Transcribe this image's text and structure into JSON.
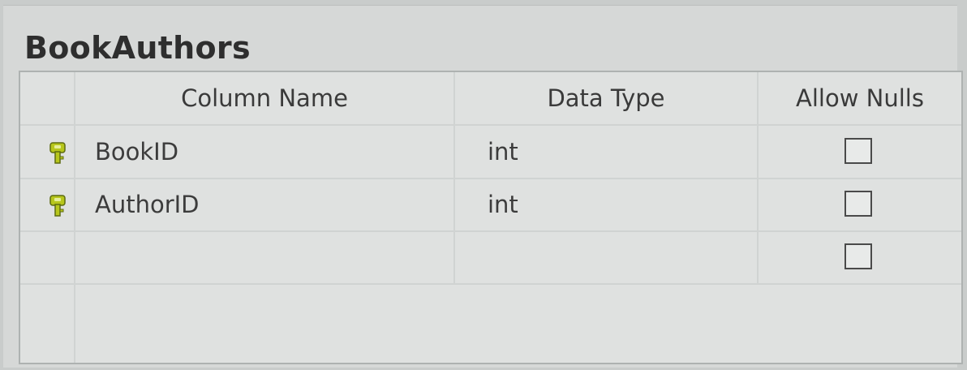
{
  "table": {
    "title": "BookAuthors"
  },
  "columns": {
    "name": "Column Name",
    "data_type": "Data Type",
    "allow_nulls": "Allow Nulls"
  },
  "rows": [
    {
      "name": "BookID",
      "data_type": "int",
      "allow_nulls": false,
      "primary_key": true,
      "icon": "key-icon"
    },
    {
      "name": "AuthorID",
      "data_type": "int",
      "allow_nulls": false,
      "primary_key": true,
      "icon": "key-icon"
    },
    {
      "name": "",
      "data_type": "",
      "allow_nulls": false,
      "primary_key": false
    }
  ],
  "colors": {
    "key_icon": "#b7c61c",
    "background": "#d6d8d7"
  }
}
